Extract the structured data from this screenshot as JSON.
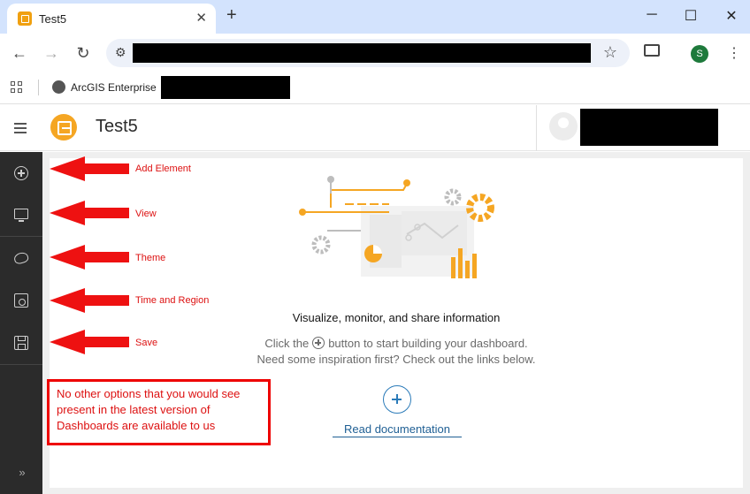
{
  "browser": {
    "tab_title": "Test5",
    "tab_close": "✕",
    "new_tab": "+",
    "win_min": "─",
    "win_max": "☐",
    "win_close": "✕",
    "back": "←",
    "forward": "→",
    "reload": "↻",
    "star": "☆",
    "tune": "⚙",
    "profile_initial": "S",
    "menu": "⋮",
    "bookmark_label": "ArcGIS Enterprise"
  },
  "app": {
    "title": "Test5"
  },
  "rail": {
    "expand": "»"
  },
  "annotations": {
    "add_element": "Add Element",
    "view": "View",
    "theme": "Theme",
    "time_region": "Time and Region",
    "save": "Save",
    "note": "No other options that you would see present in the latest version of Dashboards are available to us"
  },
  "empty_state": {
    "title": "Visualize, monitor, and share information",
    "line1_before": "Click the",
    "line1_after": "button to start building your dashboard.",
    "line2": "Need some inspiration first? Check out the links below.",
    "link": "Read documentation"
  },
  "colors": {
    "accent": "#f5a623",
    "link": "#1f5f94",
    "annotation": "#dd1111",
    "rail": "#2b2b2b"
  }
}
